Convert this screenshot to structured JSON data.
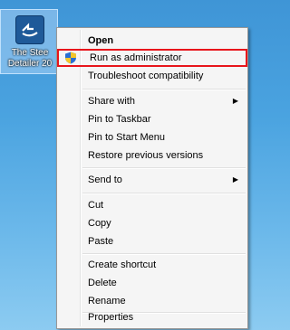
{
  "desktop_icon": {
    "label_line1": "The Stee",
    "label_line2": "Detailer 20"
  },
  "context_menu": {
    "items": [
      {
        "label": "Open"
      },
      {
        "label": "Run as administrator"
      },
      {
        "label": "Troubleshoot compatibility"
      },
      {
        "label": "Share with"
      },
      {
        "label": "Pin to Taskbar"
      },
      {
        "label": "Pin to Start Menu"
      },
      {
        "label": "Restore previous versions"
      },
      {
        "label": "Send to"
      },
      {
        "label": "Cut"
      },
      {
        "label": "Copy"
      },
      {
        "label": "Paste"
      },
      {
        "label": "Create shortcut"
      },
      {
        "label": "Delete"
      },
      {
        "label": "Rename"
      },
      {
        "label": "Properties"
      }
    ],
    "submenu_arrow": "▶"
  },
  "colors": {
    "highlight_border": "#e8151b",
    "desktop": "#4aa3e0"
  },
  "icons": {
    "app_icon": "steel-detailer-app-icon",
    "uac_icon": "uac-shield-icon"
  }
}
